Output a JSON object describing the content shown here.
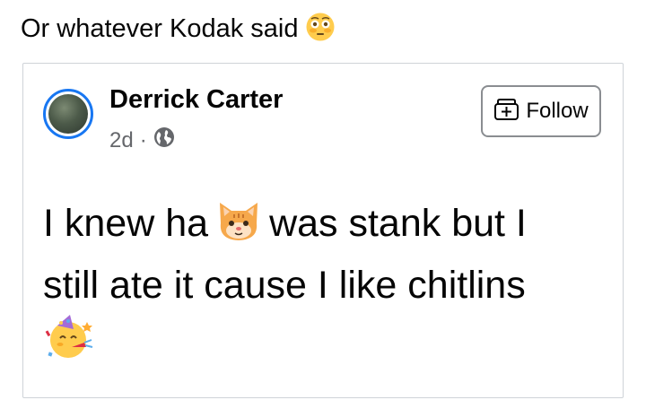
{
  "caption": {
    "text": "Or whatever Kodak said",
    "emoji": "flushed-face-icon"
  },
  "post": {
    "author": "Derrick Carter",
    "time": "2d",
    "separator": "·",
    "privacy_icon": "globe-icon",
    "follow_label": "Follow",
    "follow_icon": "add-friend-icon",
    "body_part1": "I knew ha",
    "body_emoji_1": "cat-face-icon",
    "body_part2": "was stank but I",
    "body_line2": "still ate it cause I like chitlins",
    "body_emoji_2": "partying-face-icon"
  },
  "colors": {
    "avatar_ring": "#1877f2",
    "secondary_text": "#65676b",
    "border": "#cfd3d8"
  }
}
